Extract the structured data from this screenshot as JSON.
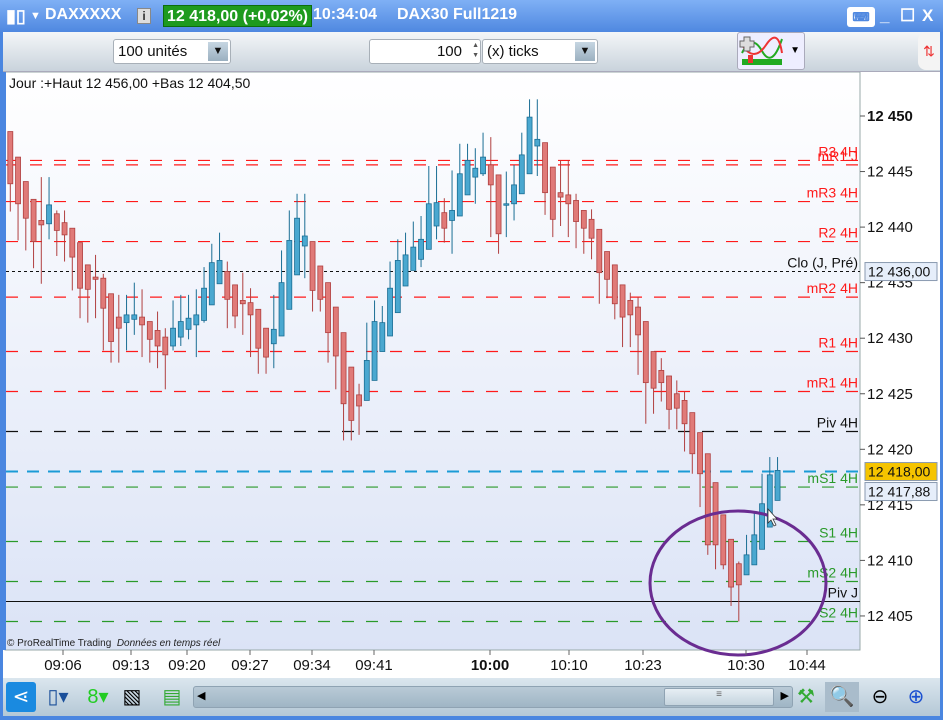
{
  "window": {
    "symbol": "DAXXXXX",
    "price_badge": "12 418,00 (+0,02%)",
    "time": "10:34:04",
    "instrument": "DAX30 Full1219",
    "icons": [
      "candlestick-icon",
      "info-icon",
      "keyboard-icon",
      "minimize-icon",
      "maximize-icon",
      "close-icon"
    ]
  },
  "toolbar": {
    "units_select": "100 unités",
    "ticks_value": "100",
    "ticks_select": "(x) ticks",
    "icons": [
      "indicators-icon",
      "sync-icon"
    ]
  },
  "chart": {
    "info_line": "Jour :+Haut 12 456,00 +Bas 12 404,50",
    "copyright": "© ProRealTime Trading",
    "realtime_note": "Données en temps réel",
    "price_ticks": [
      "12 450",
      "12 445",
      "12 440",
      "12 435",
      "12 430",
      "12 425",
      "12 420",
      "12 415",
      "12 410",
      "12 405"
    ],
    "last_price_tag": "12 418,00",
    "cursor_price_tag": "12 417,88",
    "clo_price_tag": "12 436,00",
    "time_ticks": [
      "09:06",
      "09:13",
      "09:20",
      "09:27",
      "09:34",
      "09:41",
      "10:00",
      "10:10",
      "10:23",
      "10:30",
      "10:44"
    ],
    "colors": {
      "up": "#4aa8d0",
      "down": "#e07a78",
      "resistance": "#ff1a1a",
      "support": "#2a9a2a",
      "pivot": "#111111",
      "last": "#1a9bd6",
      "annotation": "#6a2c91",
      "price_tag": "#f5c400"
    }
  },
  "levels": [
    {
      "label": "R3 4H",
      "price": 12446.0,
      "kind": "resistance"
    },
    {
      "label": "mR1 J",
      "price": 12445.6,
      "kind": "resistance"
    },
    {
      "label": "mR3 4H",
      "price": 12442.3,
      "kind": "resistance"
    },
    {
      "label": "R2 4H",
      "price": 12438.7,
      "kind": "resistance"
    },
    {
      "label": "Clo (J, Pré)",
      "price": 12436.0,
      "kind": "close"
    },
    {
      "label": "mR2 4H",
      "price": 12433.7,
      "kind": "resistance"
    },
    {
      "label": "R1 4H",
      "price": 12428.8,
      "kind": "resistance"
    },
    {
      "label": "mR1 4H",
      "price": 12425.2,
      "kind": "resistance"
    },
    {
      "label": "Piv 4H",
      "price": 12421.6,
      "kind": "pivot"
    },
    {
      "label": "mS1 4H",
      "price": 12416.6,
      "kind": "support"
    },
    {
      "label": "S1 4H",
      "price": 12411.7,
      "kind": "support"
    },
    {
      "label": "mS2 4H",
      "price": 12408.1,
      "kind": "support"
    },
    {
      "label": "Piv J",
      "price": 12406.3,
      "kind": "pivotday"
    },
    {
      "label": "S2 4H",
      "price": 12404.5,
      "kind": "support"
    }
  ],
  "chart_data": {
    "type": "candlestick",
    "ylim": [
      12402.5,
      12453.5
    ],
    "last_price": 12418.0,
    "x": [
      "09:06",
      "09:13",
      "09:20",
      "09:27",
      "09:34",
      "09:41",
      "10:00",
      "10:10",
      "10:23",
      "10:30",
      "10:44"
    ],
    "ohlc": [
      [
        12448.6,
        12448.6,
        12441.4,
        12443.9
      ],
      [
        12446.3,
        12446.3,
        12438.8,
        12442.1
      ],
      [
        12444.1,
        12444.1,
        12437.9,
        12440.8
      ],
      [
        12442.5,
        12442.5,
        12436.3,
        12438.7
      ],
      [
        12440.6,
        12444.5,
        12434.9,
        12440.2
      ],
      [
        12440.3,
        12444.5,
        12438.9,
        12442.0
      ],
      [
        12441.2,
        12441.5,
        12437.4,
        12439.7
      ],
      [
        12440.4,
        12441.5,
        12436.9,
        12439.3
      ],
      [
        12439.9,
        12439.9,
        12434.3,
        12437.3
      ],
      [
        12438.6,
        12438.6,
        12431.8,
        12434.5
      ],
      [
        12436.6,
        12436.6,
        12431.4,
        12434.4
      ],
      [
        12435.5,
        12437.5,
        12431.8,
        12435.3
      ],
      [
        12435.4,
        12435.8,
        12428.9,
        12432.7
      ],
      [
        12434.0,
        12434.0,
        12427.8,
        12429.7
      ],
      [
        12431.9,
        12433.9,
        12427.8,
        12430.9
      ],
      [
        12431.4,
        12433.9,
        12428.9,
        12432.1
      ],
      [
        12431.7,
        12435.0,
        12430.3,
        12432.1
      ],
      [
        12431.9,
        12434.4,
        12428.3,
        12431.2
      ],
      [
        12431.5,
        12431.5,
        12427.8,
        12429.9
      ],
      [
        12430.7,
        12432.4,
        12427.3,
        12429.3
      ],
      [
        12430.1,
        12430.9,
        12425.4,
        12428.5
      ],
      [
        12429.3,
        12433.4,
        12428.9,
        12430.9
      ],
      [
        12430.1,
        12433.9,
        12429.3,
        12431.5
      ],
      [
        12430.8,
        12433.9,
        12429.9,
        12431.8
      ],
      [
        12431.2,
        12434.4,
        12428.3,
        12432.1
      ],
      [
        12431.6,
        12436.4,
        12431.4,
        12434.5
      ],
      [
        12433.0,
        12438.5,
        12433.0,
        12436.8
      ],
      [
        12434.9,
        12439.5,
        12434.9,
        12437.0
      ],
      [
        12436.0,
        12436.9,
        12430.9,
        12433.5
      ],
      [
        12434.8,
        12434.8,
        12430.9,
        12432.0
      ],
      [
        12433.4,
        12435.9,
        12430.3,
        12433.1
      ],
      [
        12433.2,
        12434.5,
        12428.3,
        12432.1
      ],
      [
        12432.6,
        12432.6,
        12426.8,
        12429.1
      ],
      [
        12430.9,
        12430.9,
        12426.8,
        12428.3
      ],
      [
        12429.5,
        12433.9,
        12427.3,
        12430.8
      ],
      [
        12430.2,
        12437.9,
        12430.2,
        12435.0
      ],
      [
        12432.6,
        12441.5,
        12432.6,
        12438.8
      ],
      [
        12435.7,
        12443.0,
        12435.7,
        12440.8
      ],
      [
        12438.3,
        12443.0,
        12435.4,
        12439.2
      ],
      [
        12438.7,
        12438.7,
        12432.4,
        12434.3
      ],
      [
        12436.5,
        12436.5,
        12432.4,
        12433.5
      ],
      [
        12435.0,
        12435.0,
        12427.8,
        12430.5
      ],
      [
        12432.8,
        12432.8,
        12425.4,
        12428.4
      ],
      [
        12430.5,
        12430.5,
        12420.8,
        12424.1
      ],
      [
        12427.4,
        12427.4,
        12420.8,
        12422.6
      ],
      [
        12424.9,
        12425.9,
        12421.3,
        12423.9
      ],
      [
        12424.4,
        12431.4,
        12424.4,
        12428.0
      ],
      [
        12426.2,
        12433.4,
        12426.2,
        12431.5
      ],
      [
        12428.8,
        12432.9,
        12428.8,
        12431.4
      ],
      [
        12430.2,
        12436.9,
        12430.2,
        12434.5
      ],
      [
        12432.3,
        12438.9,
        12432.3,
        12437.0
      ],
      [
        12434.7,
        12439.5,
        12434.7,
        12437.5
      ],
      [
        12436.1,
        12440.5,
        12436.1,
        12438.2
      ],
      [
        12437.1,
        12441.0,
        12436.4,
        12438.9
      ],
      [
        12438.0,
        12445.5,
        12438.0,
        12442.1
      ],
      [
        12440.1,
        12445.5,
        12438.9,
        12442.2
      ],
      [
        12441.3,
        12442.6,
        12438.6,
        12439.9
      ],
      [
        12440.6,
        12445.1,
        12437.6,
        12441.5
      ],
      [
        12441.0,
        12447.5,
        12441.0,
        12444.8
      ],
      [
        12442.9,
        12447.5,
        12442.9,
        12446.0
      ],
      [
        12444.5,
        12447.1,
        12442.1,
        12445.3
      ],
      [
        12444.8,
        12448.5,
        12444.6,
        12446.3
      ],
      [
        12445.6,
        12448.1,
        12439.1,
        12443.8
      ],
      [
        12444.7,
        12444.7,
        12437.6,
        12439.4
      ],
      [
        12442.1,
        12445.0,
        12439.1,
        12442.1
      ],
      [
        12442.1,
        12445.6,
        12440.6,
        12443.8
      ],
      [
        12443.0,
        12448.5,
        12443.0,
        12446.5
      ],
      [
        12444.8,
        12451.5,
        12444.8,
        12449.9
      ],
      [
        12447.3,
        12451.5,
        12444.6,
        12447.9
      ],
      [
        12447.6,
        12447.6,
        12441.1,
        12443.1
      ],
      [
        12445.4,
        12445.4,
        12439.1,
        12440.7
      ],
      [
        12443.1,
        12446.0,
        12440.1,
        12442.7
      ],
      [
        12442.9,
        12446.0,
        12439.1,
        12442.1
      ],
      [
        12442.4,
        12443.0,
        12438.1,
        12440.5
      ],
      [
        12441.5,
        12441.5,
        12437.6,
        12439.9
      ],
      [
        12440.7,
        12441.6,
        12437.1,
        12439.0
      ],
      [
        12439.8,
        12439.8,
        12433.1,
        12435.9
      ],
      [
        12437.8,
        12437.8,
        12433.6,
        12435.3
      ],
      [
        12436.6,
        12436.6,
        12431.7,
        12433.1
      ],
      [
        12434.8,
        12434.8,
        12429.2,
        12431.9
      ],
      [
        12433.4,
        12434.1,
        12429.2,
        12432.1
      ],
      [
        12432.8,
        12433.7,
        12426.7,
        12430.3
      ],
      [
        12431.5,
        12431.5,
        12422.3,
        12426.0
      ],
      [
        12428.8,
        12428.8,
        12423.2,
        12425.5
      ],
      [
        12427.1,
        12428.2,
        12424.3,
        12426.0
      ],
      [
        12426.6,
        12426.6,
        12421.8,
        12423.6
      ],
      [
        12425.0,
        12426.2,
        12421.8,
        12423.7
      ],
      [
        12424.4,
        12425.2,
        12419.8,
        12422.3
      ],
      [
        12423.3,
        12423.3,
        12417.8,
        12419.6
      ],
      [
        12421.5,
        12421.5,
        12414.8,
        12417.8
      ],
      [
        12419.6,
        12419.6,
        12410.5,
        12411.4
      ],
      [
        12417.0,
        12417.0,
        12409.2,
        12411.4
      ],
      [
        12414.1,
        12414.1,
        12409.2,
        12409.6
      ],
      [
        12411.9,
        12411.9,
        12405.9,
        12407.6
      ],
      [
        12409.7,
        12409.9,
        12404.5,
        12407.8
      ],
      [
        12408.7,
        12412.3,
        12408.7,
        12410.5
      ],
      [
        12409.6,
        12414.4,
        12409.6,
        12412.3
      ],
      [
        12411.0,
        12417.8,
        12411.0,
        12415.1
      ],
      [
        12413.0,
        12419.3,
        12413.0,
        12417.7
      ],
      [
        12415.4,
        12419.3,
        12415.4,
        12418.1
      ]
    ]
  },
  "bottombar": {
    "icons": [
      "share-icon",
      "layout-icon",
      "link-icon",
      "chart-style-icon",
      "bars-icon",
      "scroll-left-icon",
      "scroll-right-icon",
      "tools-icon",
      "auto-zoom-icon",
      "zoom-out-icon",
      "zoom-in-icon"
    ]
  }
}
